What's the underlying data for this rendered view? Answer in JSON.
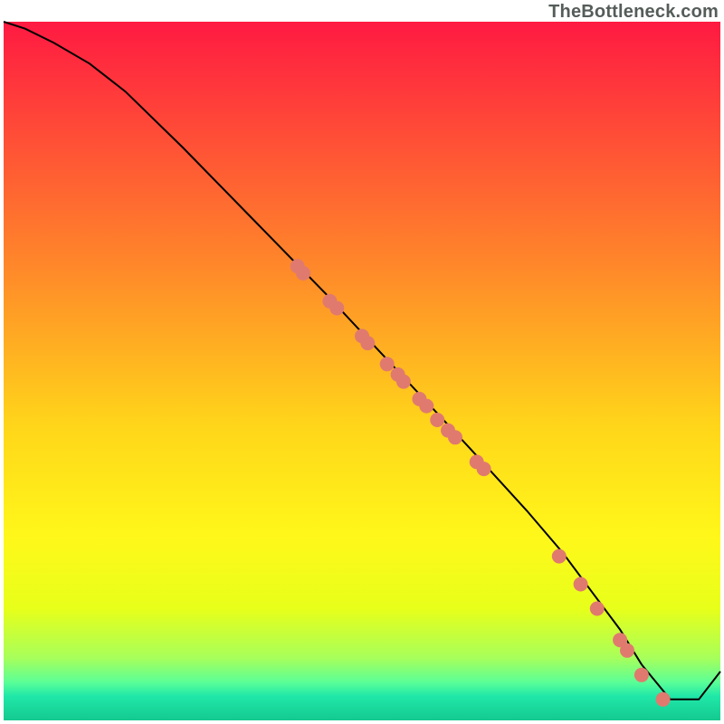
{
  "watermark": "TheBottleneck.com",
  "chart_data": {
    "type": "line",
    "title": "",
    "xlabel": "",
    "ylabel": "",
    "xlim": [
      0,
      100
    ],
    "ylim": [
      0,
      100
    ],
    "background": {
      "gradient_stops": [
        {
          "offset": 0.0,
          "color": "#ff1a42"
        },
        {
          "offset": 0.36,
          "color": "#ff8b29"
        },
        {
          "offset": 0.58,
          "color": "#ffd61a"
        },
        {
          "offset": 0.74,
          "color": "#fff81a"
        },
        {
          "offset": 0.84,
          "color": "#e7ff1a"
        },
        {
          "offset": 0.91,
          "color": "#a8ff5a"
        },
        {
          "offset": 0.945,
          "color": "#5cff96"
        },
        {
          "offset": 0.965,
          "color": "#20e8a8"
        },
        {
          "offset": 1.0,
          "color": "#14c98f"
        }
      ]
    },
    "series": [
      {
        "name": "bottleneck-curve",
        "color": "#000000",
        "x": [
          0,
          3,
          7,
          12,
          17,
          25,
          35,
          45,
          55,
          65,
          73,
          78,
          82,
          86,
          89,
          93,
          97,
          100
        ],
        "y": [
          100,
          99,
          97,
          94,
          90,
          82,
          71.5,
          61,
          50,
          39,
          30,
          24,
          18.5,
          13,
          8,
          3,
          3,
          7
        ]
      }
    ],
    "scatter": {
      "name": "benchmark-points",
      "color": "#e07a6f",
      "radius": 8,
      "points": [
        {
          "x": 41,
          "y": 65
        },
        {
          "x": 41.8,
          "y": 64
        },
        {
          "x": 45.5,
          "y": 60
        },
        {
          "x": 46.5,
          "y": 59
        },
        {
          "x": 50,
          "y": 55
        },
        {
          "x": 50.8,
          "y": 54
        },
        {
          "x": 53.5,
          "y": 51
        },
        {
          "x": 55,
          "y": 49.5
        },
        {
          "x": 55.8,
          "y": 48.5
        },
        {
          "x": 58,
          "y": 46
        },
        {
          "x": 59,
          "y": 45
        },
        {
          "x": 60.5,
          "y": 43
        },
        {
          "x": 62,
          "y": 41.5
        },
        {
          "x": 63,
          "y": 40.5
        },
        {
          "x": 66,
          "y": 37
        },
        {
          "x": 67,
          "y": 36
        },
        {
          "x": 77.5,
          "y": 23.5
        },
        {
          "x": 80.5,
          "y": 19.5
        },
        {
          "x": 82.8,
          "y": 16
        },
        {
          "x": 86,
          "y": 11.5
        },
        {
          "x": 87,
          "y": 10
        },
        {
          "x": 89,
          "y": 6.5
        },
        {
          "x": 92,
          "y": 3
        }
      ]
    }
  }
}
